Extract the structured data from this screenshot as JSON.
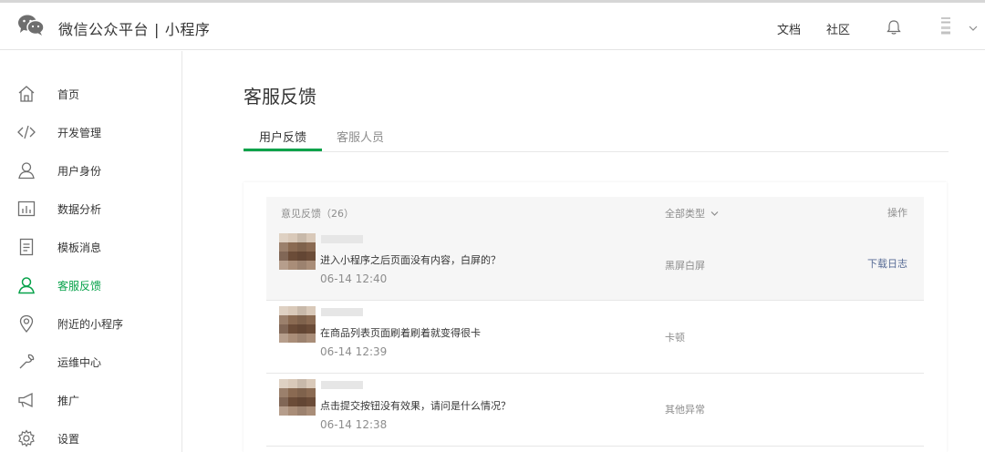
{
  "header": {
    "brand": "微信公众平台",
    "separator": "|",
    "product": "小程序",
    "links": [
      "文档",
      "社区"
    ],
    "icons": [
      "wechat-logo-icon",
      "bell-icon",
      "chevron-down-icon"
    ]
  },
  "sidebar": {
    "items": [
      {
        "label": "首页",
        "icon": "home-icon"
      },
      {
        "label": "开发管理",
        "icon": "code-icon"
      },
      {
        "label": "用户身份",
        "icon": "user-icon"
      },
      {
        "label": "数据分析",
        "icon": "bar-chart-icon"
      },
      {
        "label": "模板消息",
        "icon": "document-icon"
      },
      {
        "label": "客服反馈",
        "icon": "customer-service-icon",
        "active": true
      },
      {
        "label": "附近的小程序",
        "icon": "location-pin-icon"
      },
      {
        "label": "运维中心",
        "icon": "wrench-icon"
      },
      {
        "label": "推广",
        "icon": "megaphone-icon"
      },
      {
        "label": "设置",
        "icon": "gear-icon"
      }
    ]
  },
  "main": {
    "title": "客服反馈",
    "tabs": [
      {
        "label": "用户反馈",
        "active": true
      },
      {
        "label": "客服人员",
        "active": false
      }
    ],
    "list": {
      "count_label": "意见反馈（26）",
      "type_filter": "全部类型",
      "operation_label": "操作",
      "rows": [
        {
          "text": "进入小程序之后页面没有内容，白屏的？",
          "time": "06-14 12:40",
          "type": "黑屏白屏",
          "action": "下载日志"
        },
        {
          "text": "在商品列表页面刷着刷着就变得很卡",
          "time": "06-14 12:39",
          "type": "卡顿",
          "action": ""
        },
        {
          "text": "点击提交按钮没有效果，请问是什么情况？",
          "time": "06-14 12:38",
          "type": "其他异常",
          "action": ""
        }
      ]
    }
  },
  "colors": {
    "accent": "#07a24a",
    "link": "#576b95",
    "muted": "#8d8d8d",
    "text": "#353535"
  }
}
